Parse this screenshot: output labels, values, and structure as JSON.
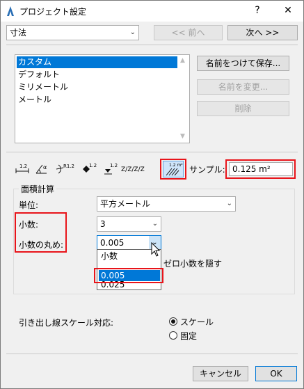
{
  "window": {
    "title": "プロジェクト設定",
    "help": "?",
    "close": "✕"
  },
  "top": {
    "unit_combo": "寸法",
    "prev_button": "<< 前へ",
    "next_button": "次へ >>"
  },
  "presets": {
    "items": [
      "カスタム",
      "デフォルト",
      "ミリメートル",
      "メートル"
    ],
    "selected_index": 0,
    "save_button": "名前をつけて保存...",
    "rename_button": "名前を変更...",
    "delete_button": "削除"
  },
  "dimension_types": {
    "icons": [
      "1.2",
      "α",
      "R 1.2",
      "1.2",
      "1.2",
      "2/2/2",
      "1.2 m²"
    ],
    "sample_label": "サンプル:",
    "sample_value": "0.125 m²"
  },
  "area_calc": {
    "group_title": "面積計算",
    "unit_label": "単位:",
    "unit_value": "平方メートル",
    "decimals_label": "小数:",
    "decimals_value": "3",
    "rounding_label": "小数の丸め:",
    "rounding_value": "0.005",
    "rounding_options": [
      "小数",
      "0.005",
      "0.025"
    ],
    "rounding_highlighted": "0.005",
    "hide_zero_label": "ゼロ小数を隠す"
  },
  "leader": {
    "label": "引き出し線スケール対応:",
    "option_scale": "スケール",
    "option_fixed": "固定",
    "selected": "スケール"
  },
  "footer": {
    "cancel_button": "キャンセル",
    "ok_button": "OK"
  },
  "colors": {
    "highlight": "#e8141a",
    "selection": "#0078d7"
  }
}
